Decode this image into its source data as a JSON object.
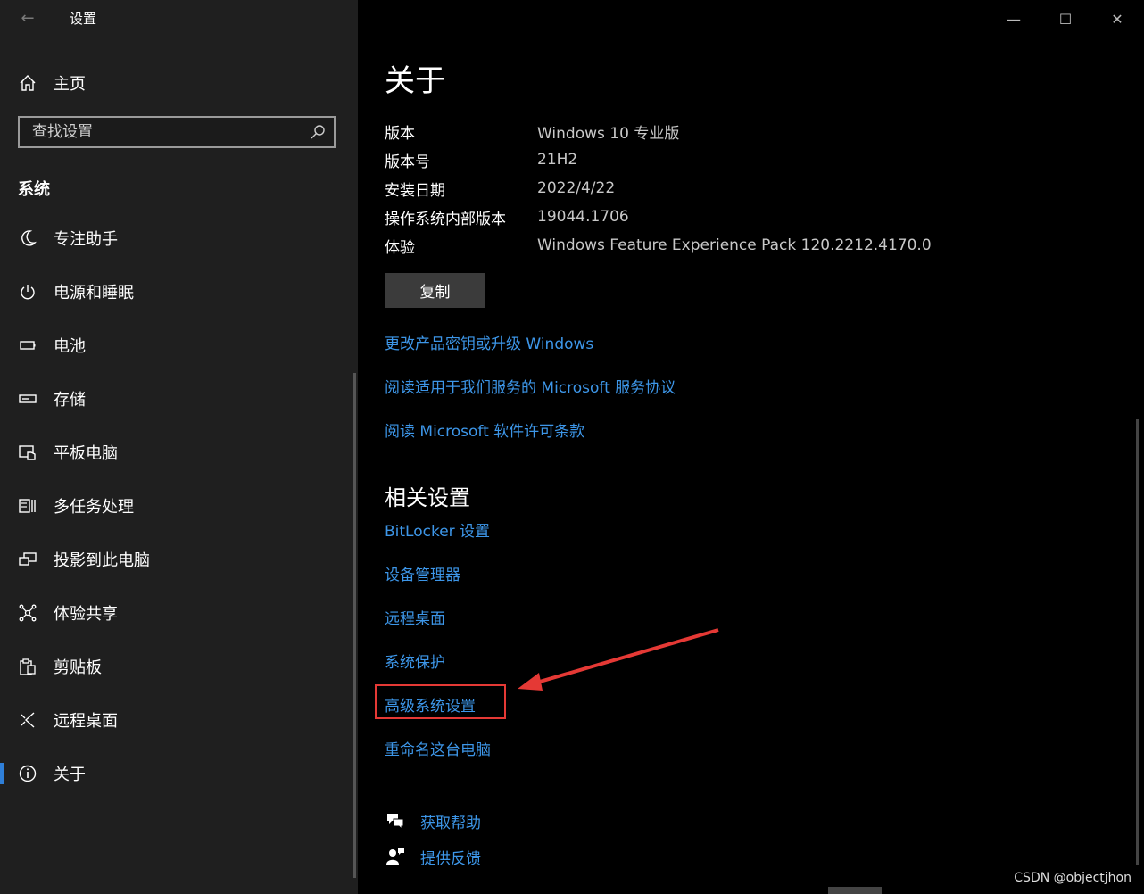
{
  "window": {
    "title": "设置"
  },
  "sidebar": {
    "home_label": "主页",
    "search_placeholder": "查找设置",
    "section_title": "系统",
    "items": [
      {
        "label": "专注助手",
        "icon": "moon-icon"
      },
      {
        "label": "电源和睡眠",
        "icon": "power-icon"
      },
      {
        "label": "电池",
        "icon": "battery-icon"
      },
      {
        "label": "存储",
        "icon": "storage-icon"
      },
      {
        "label": "平板电脑",
        "icon": "tablet-icon"
      },
      {
        "label": "多任务处理",
        "icon": "multitask-icon"
      },
      {
        "label": "投影到此电脑",
        "icon": "project-icon"
      },
      {
        "label": "体验共享",
        "icon": "share-icon"
      },
      {
        "label": "剪贴板",
        "icon": "clipboard-icon"
      },
      {
        "label": "远程桌面",
        "icon": "remote-icon"
      },
      {
        "label": "关于",
        "icon": "info-icon",
        "selected": true
      }
    ]
  },
  "main": {
    "title": "关于",
    "specs": [
      {
        "label": "版本",
        "value": "Windows 10 专业版"
      },
      {
        "label": "版本号",
        "value": "21H2"
      },
      {
        "label": "安装日期",
        "value": "2022/4/22"
      },
      {
        "label": "操作系统内部版本",
        "value": "19044.1706"
      },
      {
        "label": "体验",
        "value": "Windows Feature Experience Pack 120.2212.4170.0"
      }
    ],
    "copy_label": "复制",
    "links": [
      "更改产品密钥或升级 Windows",
      "阅读适用于我们服务的 Microsoft 服务协议",
      "阅读 Microsoft 软件许可条款"
    ],
    "related_title": "相关设置",
    "related_links": [
      "BitLocker 设置",
      "设备管理器",
      "远程桌面",
      "系统保护",
      "高级系统设置",
      "重命名这台电脑"
    ],
    "help_links": [
      {
        "label": "获取帮助",
        "icon": "help-chat-icon"
      },
      {
        "label": "提供反馈",
        "icon": "feedback-icon"
      }
    ]
  },
  "watermark": "CSDN @objectjhon",
  "colors": {
    "accent": "#3d96e8",
    "highlight": "#e53935",
    "sidebar_bg": "#1f1f1f"
  }
}
